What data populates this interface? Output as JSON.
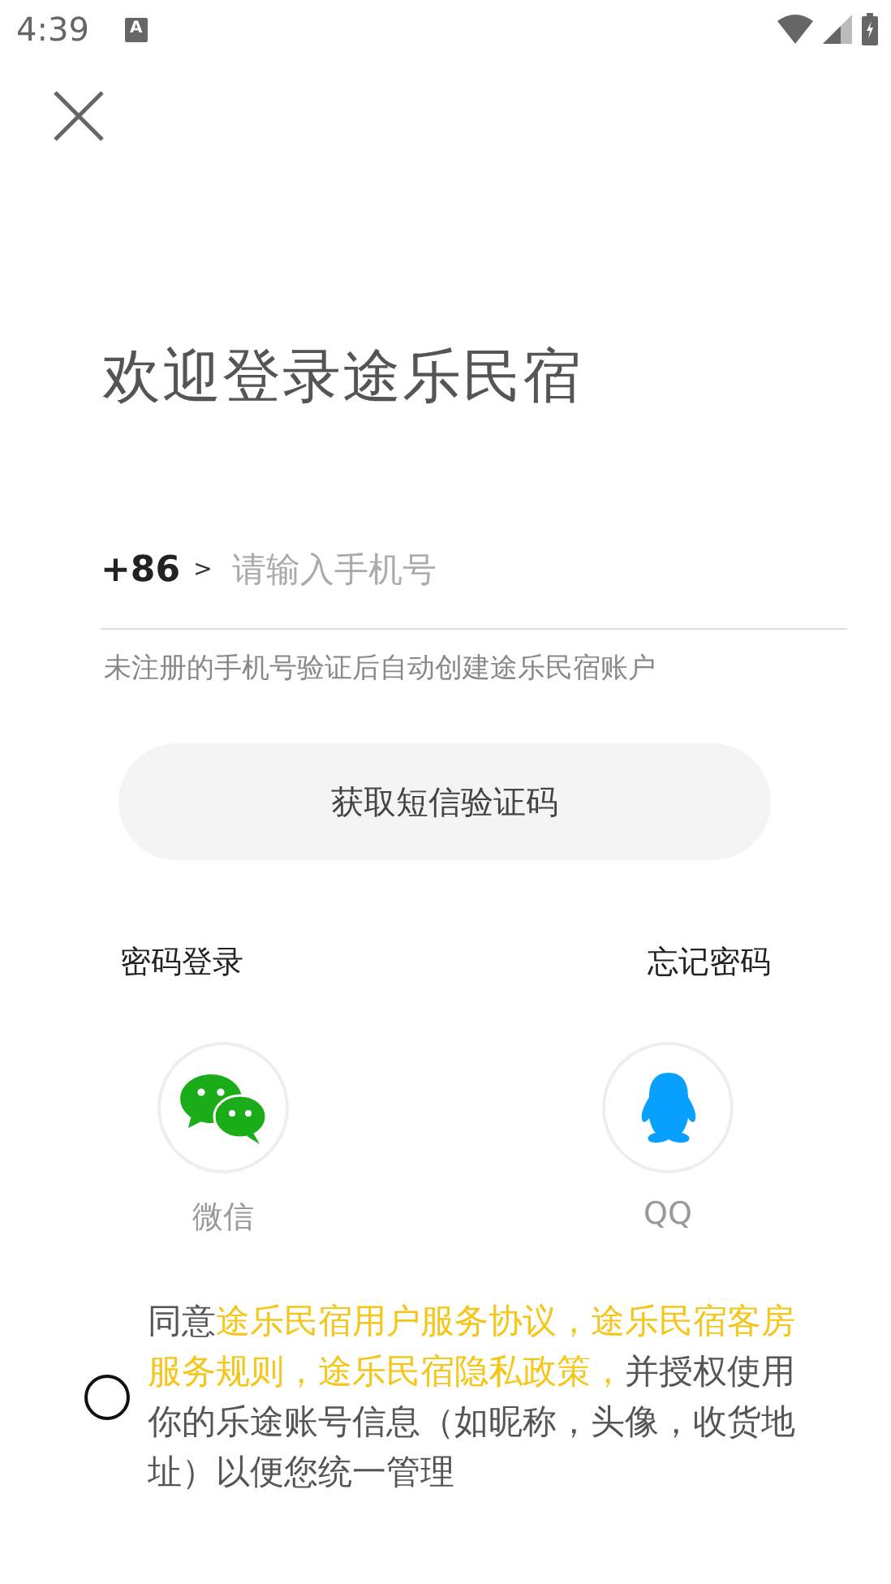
{
  "status_bar": {
    "time": "4:39",
    "notification_icon": "A"
  },
  "title": "欢迎登录途乐民宿",
  "phone": {
    "country_code": "+86",
    "chevron": ">",
    "placeholder": "请输入手机号"
  },
  "hint": "未注册的手机号验证后自动创建途乐民宿账户",
  "primary_button": "获取短信验证码",
  "links": [
    "密码登录",
    "忘记密码"
  ],
  "social": [
    {
      "kind": "wechat",
      "label": "微信"
    },
    {
      "kind": "qq",
      "label": "QQ"
    }
  ],
  "agreement": {
    "checked": false,
    "segments": [
      {
        "text": "同意",
        "highlight": false
      },
      {
        "text": "途乐民宿用户服务协议，途乐民宿客房服务规则，途乐民宿隐私政策，",
        "highlight": true
      },
      {
        "text": "并授权使用你的乐途账号信息（如昵称，头像，收货地址）以便您统一管理",
        "highlight": false
      }
    ]
  }
}
